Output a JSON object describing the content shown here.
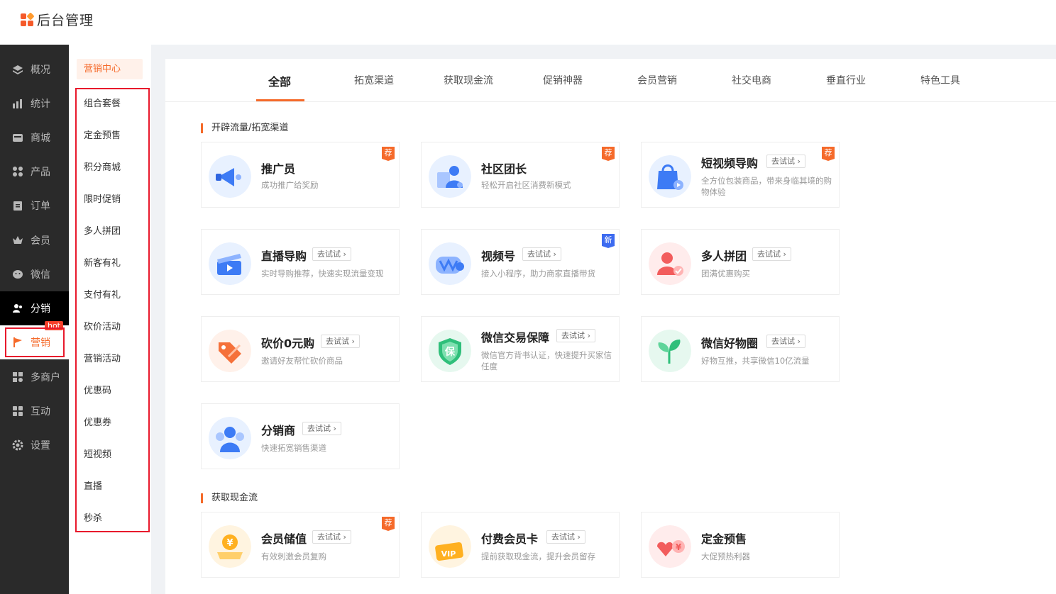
{
  "app": {
    "title": "后台管理"
  },
  "sidebar": {
    "items": [
      {
        "label": "概况",
        "icon": "dashboard-icon"
      },
      {
        "label": "统计",
        "icon": "chart-icon"
      },
      {
        "label": "商城",
        "icon": "shop-icon"
      },
      {
        "label": "产品",
        "icon": "product-icon"
      },
      {
        "label": "订单",
        "icon": "order-icon"
      },
      {
        "label": "会员",
        "icon": "crown-icon"
      },
      {
        "label": "微信",
        "icon": "wechat-icon"
      },
      {
        "label": "分销",
        "icon": "users-icon"
      },
      {
        "label": "营销",
        "icon": "flag-icon",
        "badge": "hot"
      },
      {
        "label": "多商户",
        "icon": "merchant-icon"
      },
      {
        "label": "互动",
        "icon": "grid-icon"
      },
      {
        "label": "设置",
        "icon": "gear-icon"
      }
    ]
  },
  "subnav": {
    "title": "营销中心",
    "items": [
      "组合套餐",
      "定金预售",
      "积分商城",
      "限时促销",
      "多人拼团",
      "新客有礼",
      "支付有礼",
      "砍价活动",
      "营销活动",
      "优惠码",
      "优惠券",
      "短视频",
      "直播",
      "秒杀"
    ]
  },
  "tabs": [
    "全部",
    "拓宽渠道",
    "获取现金流",
    "促销神器",
    "会员营销",
    "社交电商",
    "垂直行业",
    "特色工具"
  ],
  "sections": [
    {
      "title": "开辟流量/拓宽渠道"
    },
    {
      "title": "获取现金流"
    }
  ],
  "try_label": "去试试",
  "badges": {
    "recommend": "荐",
    "new": "新"
  },
  "cards": [
    {
      "name": "推广员",
      "desc": "成功推广给奖励",
      "badge": "荐"
    },
    {
      "name": "社区团长",
      "desc": "轻松开启社区消费新模式",
      "badge": "荐"
    },
    {
      "name": "短视频导购",
      "desc": "全方位包装商品，带来身临其境的购物体验",
      "try": true,
      "badge": "荐"
    },
    {
      "name": "直播导购",
      "desc": "实时导购推荐，快速实现流量变现",
      "try": true
    },
    {
      "name": "视频号",
      "desc": "接入小程序，助力商家直播带货",
      "try": true,
      "badge": "新"
    },
    {
      "name": "多人拼团",
      "desc": "团满优惠购买",
      "try": true
    },
    {
      "name": "砍价0元购",
      "desc": "邀请好友帮忙砍价商品",
      "try": true
    },
    {
      "name": "微信交易保障",
      "desc": "微信官方背书认证，快速提升买家信任度",
      "try": true
    },
    {
      "name": "微信好物圈",
      "desc": "好物互推，共享微信10亿流量",
      "try": true
    },
    {
      "name": "分销商",
      "desc": "快速拓宽销售渠道",
      "try": true
    },
    {
      "name": "会员储值",
      "desc": "有效刺激会员复购",
      "try": true,
      "badge": "荐"
    },
    {
      "name": "付费会员卡",
      "desc": "提前获取现金流，提升会员留存",
      "try": true
    },
    {
      "name": "定金预售",
      "desc": "大促预热利器"
    }
  ],
  "colors": {
    "accent": "#f56a2a",
    "sidebar_bg": "#2a2a2a",
    "highlight": "#e8192c",
    "new_badge": "#3d6bf0"
  }
}
